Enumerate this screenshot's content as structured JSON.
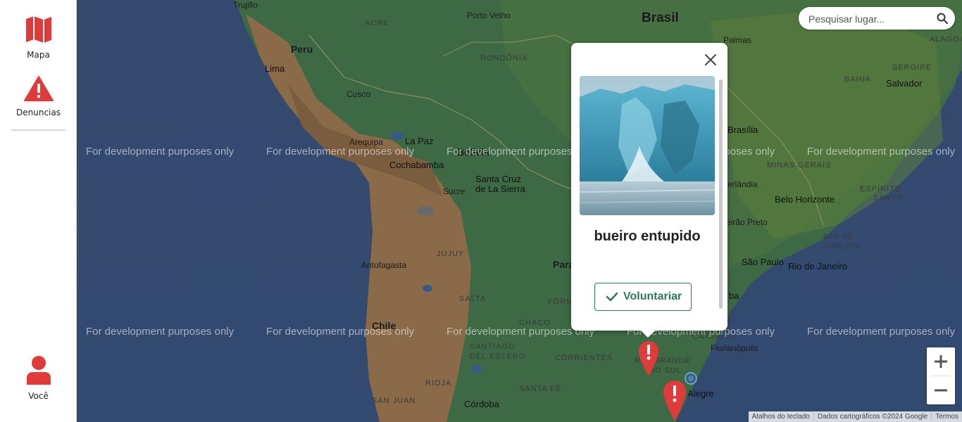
{
  "sidebar": {
    "items": [
      {
        "label": "Mapa",
        "icon": "map-icon"
      },
      {
        "label": "Denuncias",
        "icon": "alert-triangle-icon"
      }
    ],
    "user": {
      "label": "Você",
      "icon": "user-icon"
    }
  },
  "search": {
    "placeholder": "Pesquisar lugar..."
  },
  "popup": {
    "title": "bueiro entupido",
    "image": "glacier-photo",
    "action_label": "Voluntariar"
  },
  "map": {
    "watermark": "For development purposes only",
    "labels": {
      "brasil": "Brasil",
      "peru": "Peru",
      "bolivia": "Bolivia",
      "chile": "Chile",
      "paraguai": "Para",
      "trujillo": "Trujillo",
      "porto_velho": "Porto Velho",
      "acre": "ACRE",
      "rondonia": "RONDÔNIA",
      "lima": "Lima",
      "cusco": "Cusco",
      "arequipa": "Arequipa",
      "la_paz": "La Paz",
      "cochabamba": "Cochabamba",
      "santa_cruz": "Santa Cruz",
      "de_la_sierra": "de La Sierra",
      "sucre": "Sucre",
      "antofagasta": "Antofagasta",
      "jujuy": "JUJUY",
      "salta": "SALTA",
      "formosa": "FORM",
      "chaco": "CHACO",
      "santiago": "SANTIAGO",
      "del_estero": "DEL ESTERO",
      "corrientes": "CORRIENTES",
      "rioja": "RIOJA",
      "santa_fe": "SANTA FÉ",
      "san_juan": "SAN JUAN",
      "cordoba": "Córdoba",
      "palmas": "Palmas",
      "alagoas": "ALAGOA",
      "sergipe": "SERGIPE",
      "bahia": "BAHIA",
      "salvador": "Salvador",
      "brasilia": "Brasília",
      "minas": "MINAS GERAIS",
      "belo_horizonte": "Belo Horizonte",
      "espirito_santo": "ESPÍRITO",
      "santo": "SANTO",
      "rio_de": "RIO DE",
      "janeiro": "JANEIRO",
      "sao_paulo": "São Paulo",
      "rio_de_janeiro": "Rio de Janeiro",
      "catarina": "CATARINA",
      "florianopolis": "Florianópolis",
      "rio_grande": "RIO GRANDE",
      "do_sul": "DO SUL",
      "alegre": "Alegre",
      "preto": "eirão Preto",
      "andia": "erlândia",
      "ba": "ba"
    }
  },
  "zoom": {
    "in_label": "+",
    "out_label": "−"
  },
  "attribution": {
    "shortcuts": "Atalhos do teclado",
    "map_data": "Dados cartográficos ©2024 Google",
    "terms": "Termos"
  },
  "colors": {
    "accent_red": "#e03a3a",
    "volunteer_green": "#2d7a52",
    "ocean": "#344a6f"
  }
}
